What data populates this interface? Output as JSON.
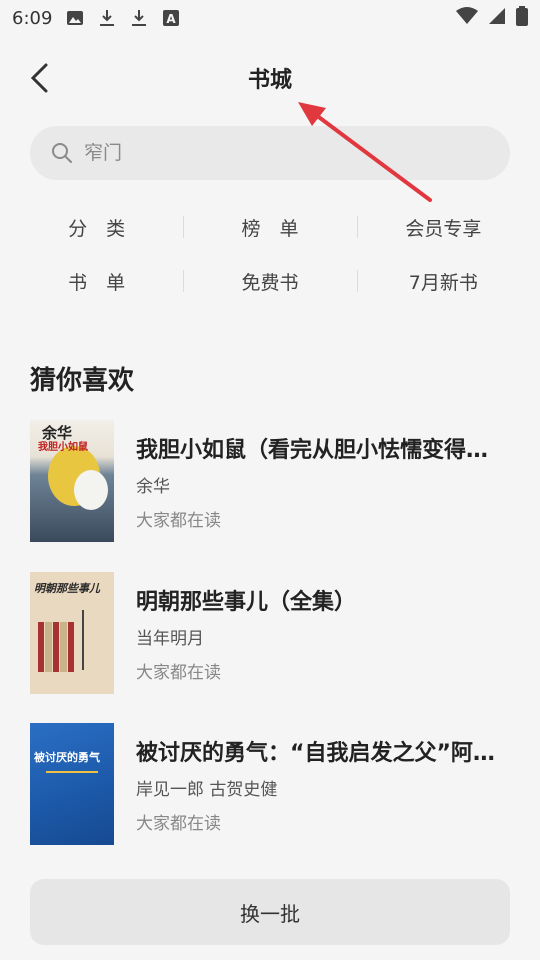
{
  "status_bar": {
    "time": "6:09",
    "icons": [
      "image-icon",
      "download-icon",
      "download-icon",
      "font-icon"
    ],
    "right_icons": [
      "wifi-icon",
      "signal-icon",
      "battery-icon"
    ]
  },
  "header": {
    "back_icon": "back-arrow-icon",
    "title": "书城"
  },
  "search": {
    "icon": "search-icon",
    "placeholder": "窄门"
  },
  "nav": {
    "row1": [
      "分　类",
      "榜　单",
      "会员专享"
    ],
    "row2": [
      "书　单",
      "免费书",
      "7月新书"
    ]
  },
  "section": {
    "title": "猜你喜欢"
  },
  "books": [
    {
      "title": "我胆小如鼠（看完从胆小怯懦变得…",
      "author": "余华",
      "meta": "大家都在读",
      "cover_text": [
        "余华",
        "我胆小如鼠"
      ]
    },
    {
      "title": "明朝那些事儿（全集）",
      "author": "当年明月",
      "meta": "大家都在读",
      "cover_text": [
        "明朝那些事儿"
      ]
    },
    {
      "title": "被讨厌的勇气：“自我启发之父”阿…",
      "author": "岸见一郎 古贺史健",
      "meta": "大家都在读",
      "cover_text": [
        "被讨厌的勇气"
      ]
    }
  ],
  "refresh_button": "换一批",
  "colors": {
    "background": "#f5f5f5",
    "search_bg": "#e9e9e9",
    "annotation_arrow": "#e0383e"
  }
}
